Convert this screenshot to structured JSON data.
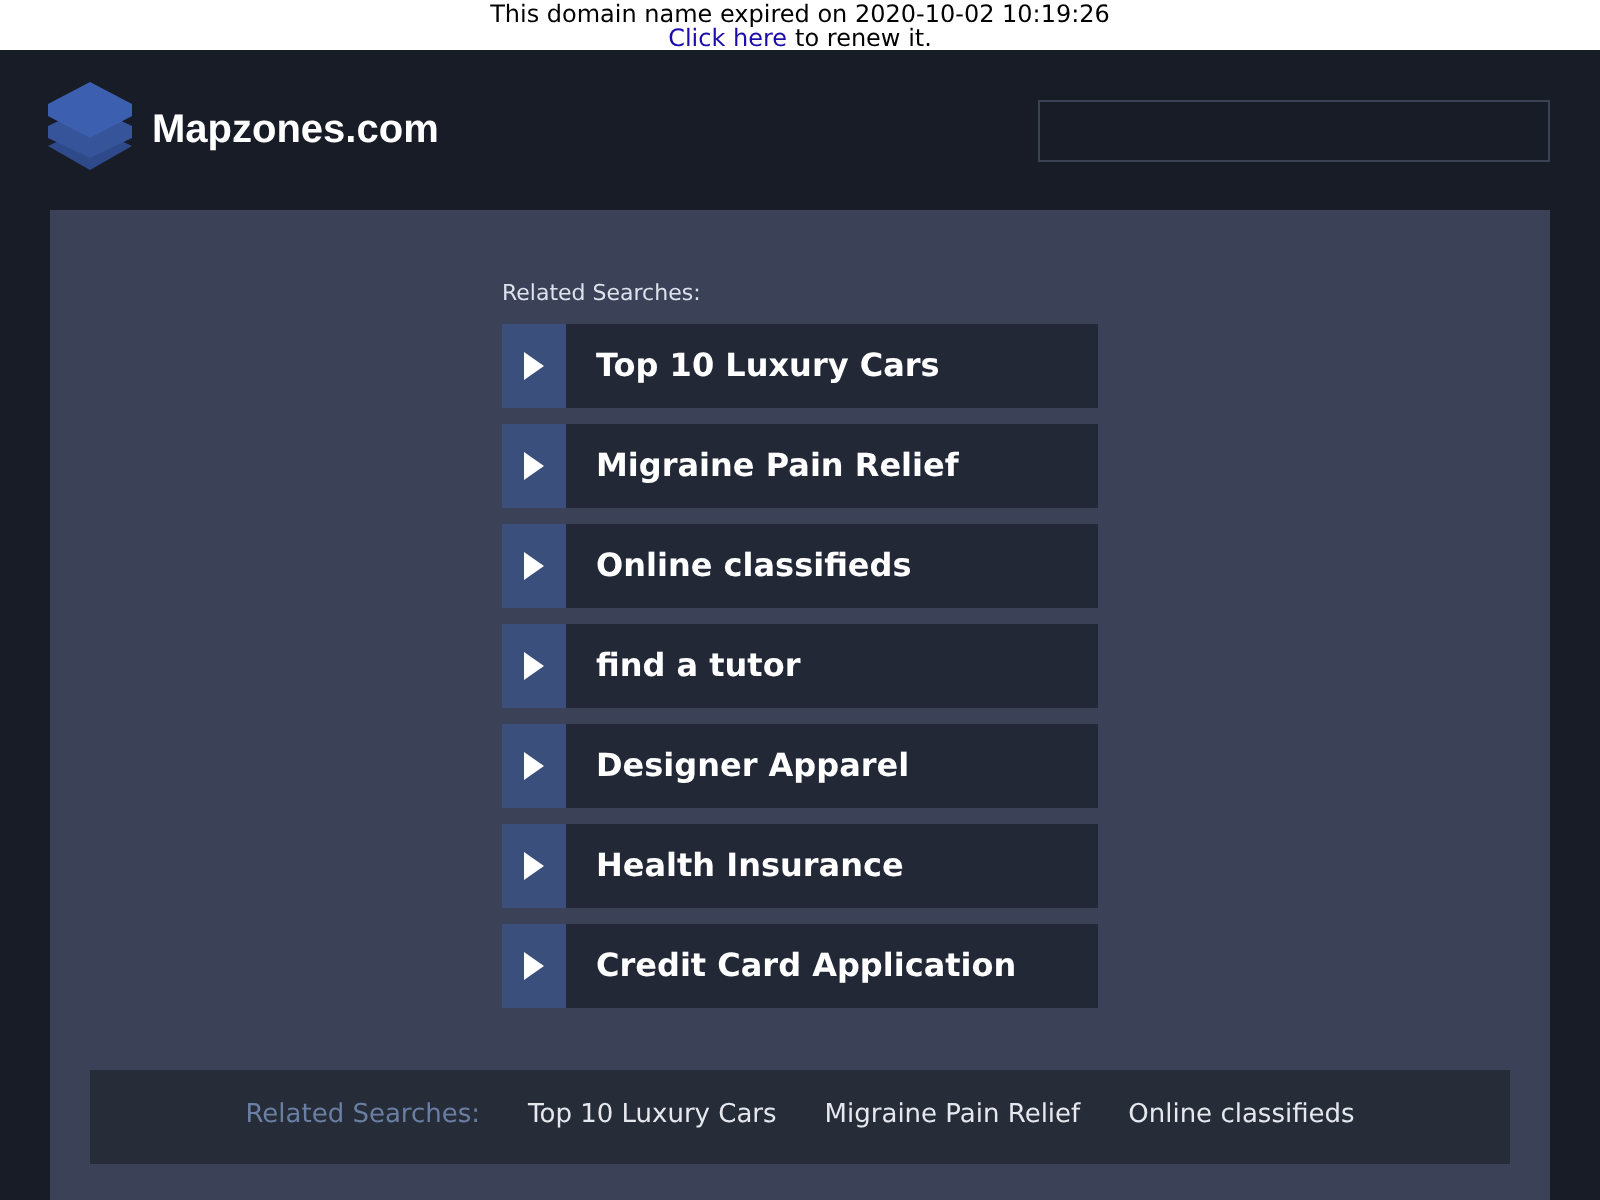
{
  "notice": {
    "message": "This domain name expired on 2020-10-02 10:19:26",
    "link": "Click here",
    "suffix": "to renew it."
  },
  "header": {
    "site_name": "Mapzones.com"
  },
  "related": {
    "heading": "Related Searches:",
    "items": [
      "Top 10 Luxury Cars",
      "Migraine Pain Relief",
      "Online classifieds",
      "find a tutor",
      "Designer Apparel",
      "Health Insurance",
      "Credit Card Application"
    ]
  },
  "footer": {
    "heading": "Related Searches:",
    "links": [
      "Top 10 Luxury Cars",
      "Migraine Pain Relief",
      "Online classifieds"
    ]
  }
}
